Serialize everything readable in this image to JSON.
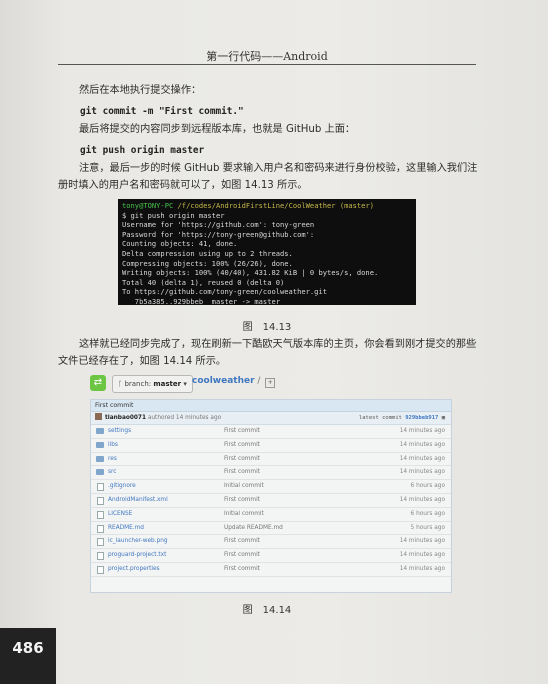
{
  "header": {
    "title": "第一行代码——Android"
  },
  "paragraphs": {
    "p1": "然后在本地执行提交操作：",
    "code1": "git commit -m \"First commit.\"",
    "p2": "最后将提交的内容同步到远程版本库，也就是 GitHub 上面：",
    "code2": "git push origin master",
    "p3": "注意，最后一步的时候 GitHub 要求输入用户名和密码来进行身份校验，这里输入我们注册时填入的用户名和密码就可以了，如图 14.13 所示。",
    "p4": "这样就已经同步完成了，现在刷新一下酷欧天气版本库的主页，你会看到刚才提交的那些文件已经存在了，如图 14.14 所示。"
  },
  "terminal": {
    "prompt_user": "tony@TONY-PC",
    "prompt_path": "/f/codes/AndroidFirstLine/CoolWeather (master)",
    "lines": [
      "$ git push origin master",
      "Username for 'https://github.com': tony-green",
      "Password for 'https://tony-green@github.com':",
      "Counting objects: 41, done.",
      "Delta compression using up to 2 threads.",
      "Compressing objects: 100% (26/26), done.",
      "Writing objects: 100% (40/40), 431.82 KiB | 0 bytes/s, done.",
      "Total 40 (delta 1), reused 0 (delta 0)",
      "To https://github.com/tony-green/coolweather.git",
      "   7b5a385..929bbeb  master -> master"
    ]
  },
  "captions": {
    "fig1": "图　14.13",
    "fig2": "图　14.14"
  },
  "github": {
    "branch_label": "branch:",
    "branch_value": "master",
    "repo_name": "coolweather",
    "repo_slash": " / ",
    "plus": "+",
    "commit_msg": "First commit",
    "author": "tianbao0071",
    "author_meta": "authored 14 minutes ago",
    "latest_label": "latest commit",
    "latest_hash": "929bbeb917",
    "files": [
      {
        "name": "settings",
        "type": "folder",
        "msg": "First commit",
        "age": "14 minutes ago"
      },
      {
        "name": "libs",
        "type": "folder",
        "msg": "First commit",
        "age": "14 minutes ago"
      },
      {
        "name": "res",
        "type": "folder",
        "msg": "First commit",
        "age": "14 minutes ago"
      },
      {
        "name": "src",
        "type": "folder",
        "msg": "First commit",
        "age": "14 minutes ago"
      },
      {
        "name": ".gitignore",
        "type": "file",
        "msg": "Initial commit",
        "age": "6 hours ago"
      },
      {
        "name": "AndroidManifest.xml",
        "type": "file",
        "msg": "First commit",
        "age": "14 minutes ago"
      },
      {
        "name": "LICENSE",
        "type": "file",
        "msg": "Initial commit",
        "age": "6 hours ago"
      },
      {
        "name": "README.md",
        "type": "file",
        "msg": "Update README.md",
        "age": "5 hours ago"
      },
      {
        "name": "ic_launcher-web.png",
        "type": "file",
        "msg": "First commit",
        "age": "14 minutes ago"
      },
      {
        "name": "proguard-project.txt",
        "type": "file",
        "msg": "First commit",
        "age": "14 minutes ago"
      },
      {
        "name": "project.properties",
        "type": "file",
        "msg": "First commit",
        "age": "14 minutes ago"
      }
    ]
  },
  "page_number": "486"
}
